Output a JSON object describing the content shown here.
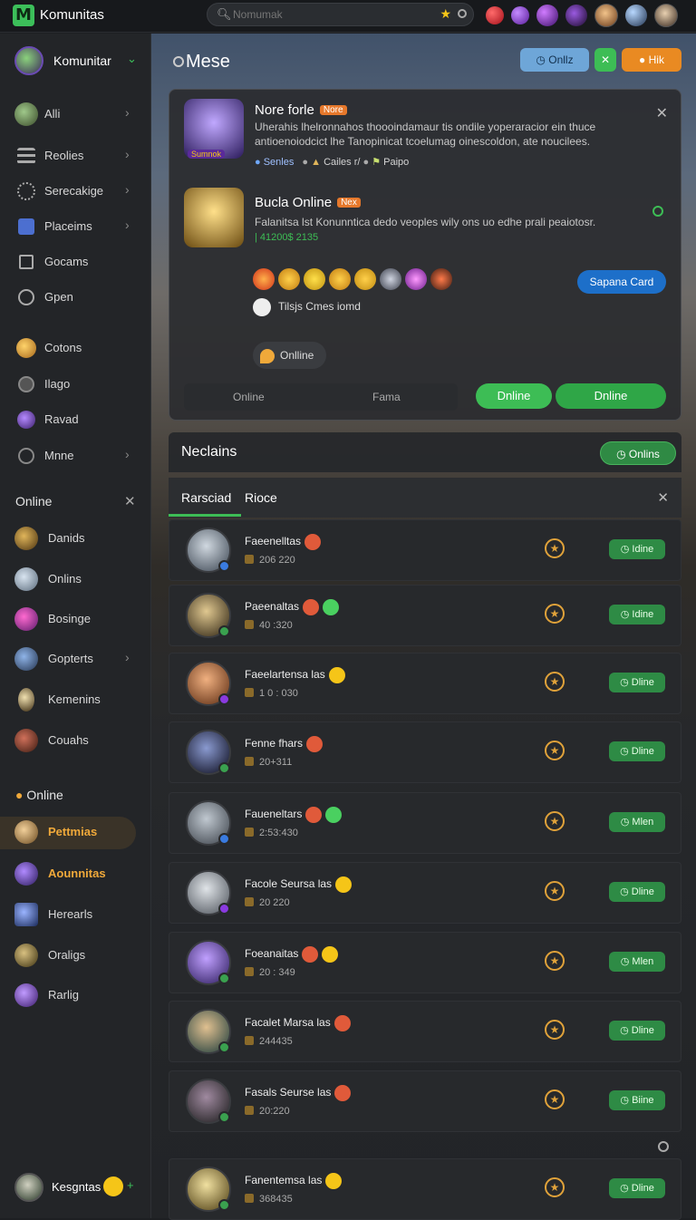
{
  "topbar": {
    "app_title": "Komunitas",
    "search_placeholder": "Nomumak"
  },
  "sidebar": {
    "user_name": "Komunitar",
    "items": [
      {
        "label": "Alli"
      },
      {
        "label": "Reolies"
      },
      {
        "label": "Serecakige"
      },
      {
        "label": "Placeims"
      },
      {
        "label": "Gocams"
      },
      {
        "label": "Gpen"
      },
      {
        "label": "Cotons"
      },
      {
        "label": "Ilago"
      },
      {
        "label": "Ravad"
      },
      {
        "label": "Mnne"
      }
    ],
    "online_header": "Online",
    "online_items": [
      {
        "label": "Danids"
      },
      {
        "label": "Onlins"
      },
      {
        "label": "Bosinge"
      },
      {
        "label": "Gopterts"
      },
      {
        "label": "Kemenins"
      },
      {
        "label": "Couahs"
      }
    ],
    "online2_header": "Online",
    "online2_items": [
      {
        "label": "Pettmias"
      },
      {
        "label": "Aounnitas"
      },
      {
        "label": "Herearls"
      },
      {
        "label": "Oraligs"
      },
      {
        "label": "Rarlig"
      }
    ],
    "bottom_user": "Kesgntas"
  },
  "main": {
    "title": "Mese",
    "btn_online": "Onllz",
    "btn_hot": "Hik"
  },
  "panel": {
    "post1": {
      "name": "Nore forle",
      "tag": "Nore",
      "text": "Uherahis lhelronnahos thoooindamaur tis ondile yoperaracior ein thuce antioenoiodcict lhe Tanopinicat tcoelumag oinescoldon, ate noucilees.",
      "badge": "Sumnok",
      "meta1": "Senles",
      "meta2": "Cailes r/",
      "meta3": "Paipo"
    },
    "post2": {
      "name": "Bucla Online",
      "tag": "Nex",
      "text": "Falanitsa lst Konunntica dedo veoples wily ons uo edhe prali peaiotosr.",
      "date": "| 41200$ 2135"
    },
    "smile_text": "Tilsjs Cmes iomd",
    "blue_btn": "Sapana Card",
    "chip": "Onlline",
    "tab_a": "Online",
    "tab_b": "Fama",
    "green1": "Dnline",
    "green2": "Dnline"
  },
  "section": {
    "title": "Neclains",
    "btn": "Onlins"
  },
  "tabs": {
    "t1": "Rarsciad",
    "t2": "Rioce"
  },
  "rows": [
    {
      "name": "Faeenelltas",
      "sub": "206 220",
      "btn": "Idine"
    },
    {
      "name": "Paeenaltas",
      "sub": "40 :320",
      "btn": "Idine"
    },
    {
      "name": "Faeelartensa las",
      "sub": "1 0 : 030",
      "btn": "Dline"
    },
    {
      "name": "Fenne fhars",
      "sub": "20+311",
      "btn": "Dline"
    },
    {
      "name": "Faueneltars",
      "sub": "2:53:430",
      "btn": "Mlen"
    },
    {
      "name": "Facole Seursa las",
      "sub": "20 220",
      "btn": "Dline"
    },
    {
      "name": "Foeanaitas",
      "sub": "20 : 349",
      "btn": "Mlen"
    },
    {
      "name": "Facalet Marsa las",
      "sub": "244435",
      "btn": "Dline"
    },
    {
      "name": "Fasals Seurse las",
      "sub": "20:220",
      "btn": "Biine"
    },
    {
      "name": "Fanentemsa las",
      "sub": "368435",
      "btn": "Dline"
    }
  ]
}
